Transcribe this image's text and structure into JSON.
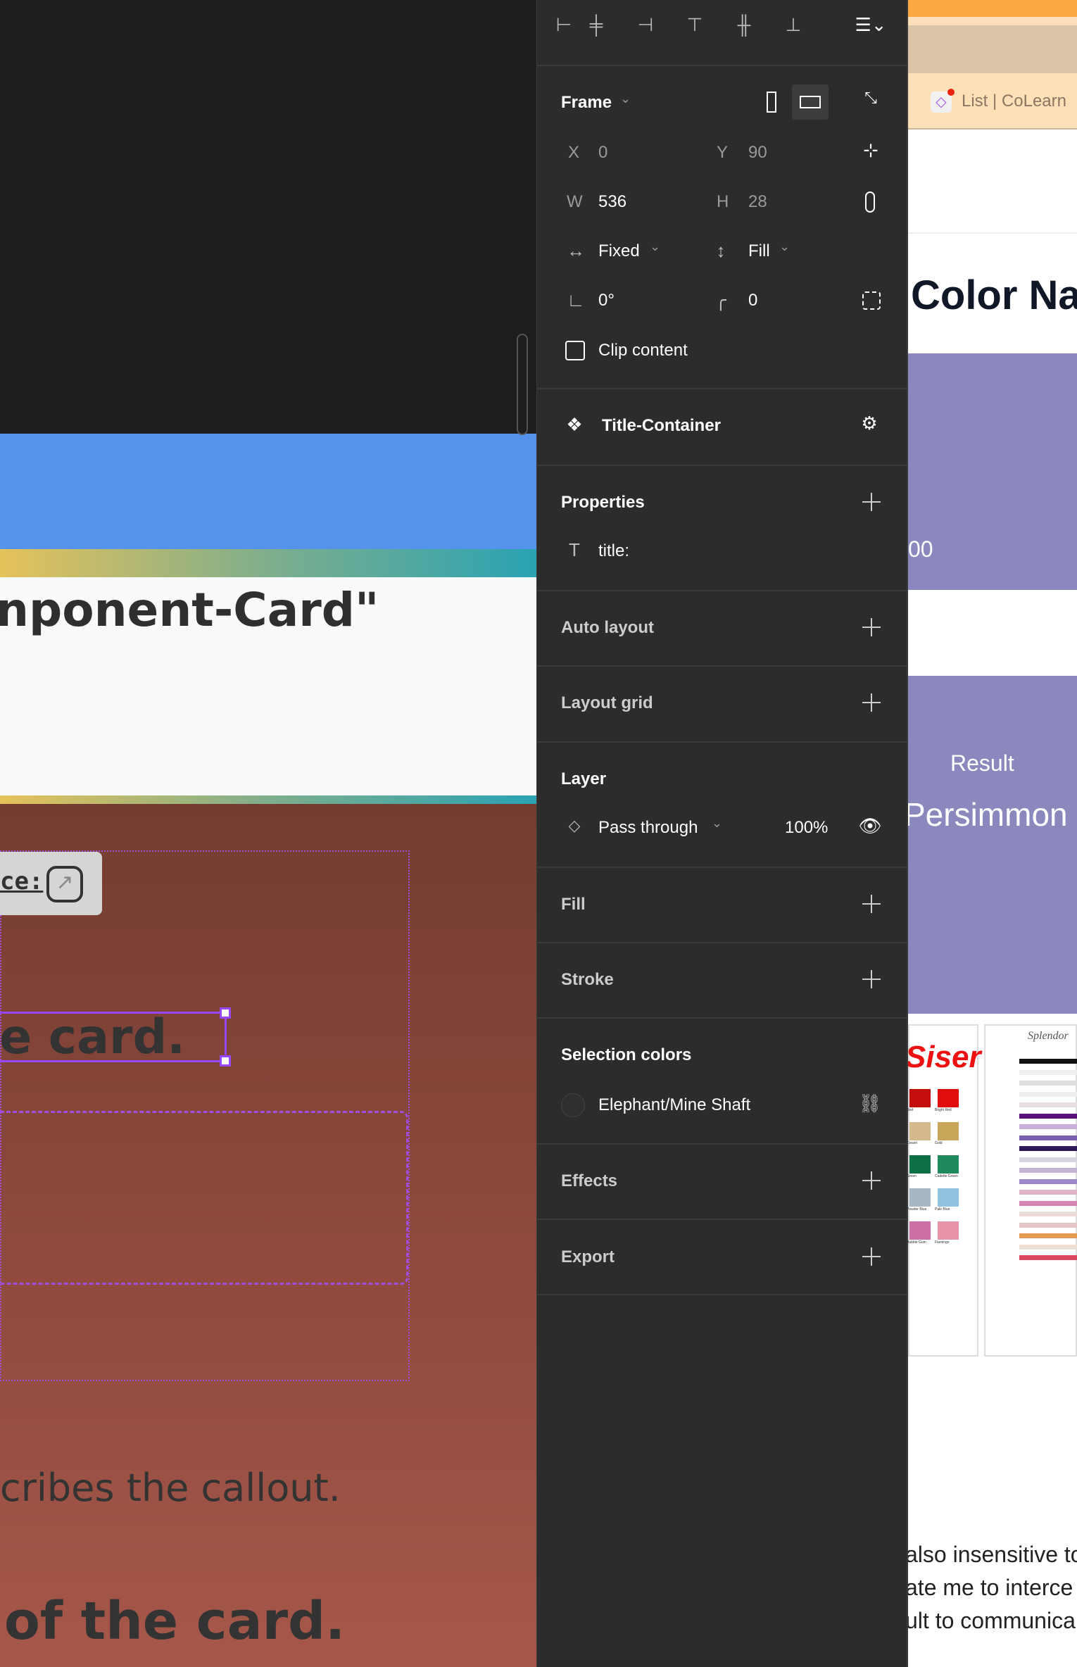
{
  "canvas": {
    "title_fragment": "nponent-Card\"",
    "link_label_fragment": "ce:",
    "selected_text_fragment": "e card.",
    "description_fragment": "cribes the callout.",
    "footer_fragment": "of the card.",
    "colors": {
      "blue": "#5592ea",
      "brown_top": "#743c31",
      "brown_bottom": "#a65749",
      "selection": "#9747ff"
    }
  },
  "panel": {
    "toolbar": {
      "icons": [
        "align-left-icon",
        "align-center-h-icon",
        "align-right-icon",
        "align-top-icon",
        "align-middle-v-icon",
        "align-bottom-icon",
        "distribute-icon"
      ]
    },
    "frame": {
      "label": "Frame",
      "x_label": "X",
      "x": "0",
      "y_label": "Y",
      "y": "90",
      "w_label": "W",
      "w": "536",
      "h_label": "H",
      "h": "28",
      "h_sizing": "Fixed",
      "v_sizing": "Fill",
      "rotation": "0°",
      "radius": "0",
      "clip_label": "Clip content",
      "clip_checked": false
    },
    "component": {
      "label": "Title-Container"
    },
    "properties": {
      "label": "Properties",
      "items": [
        {
          "label": "title:"
        }
      ]
    },
    "auto_layout": {
      "label": "Auto layout"
    },
    "layout_grid": {
      "label": "Layout grid"
    },
    "layer": {
      "label": "Layer",
      "blend": "Pass through",
      "opacity": "100%"
    },
    "fill": {
      "label": "Fill"
    },
    "stroke": {
      "label": "Stroke"
    },
    "selection_colors": {
      "label": "Selection colors",
      "items": [
        {
          "name": "Elephant/Mine Shaft",
          "color": "#2f2f2f"
        }
      ]
    },
    "effects": {
      "label": "Effects"
    },
    "export": {
      "label": "Export"
    }
  },
  "web": {
    "tab_title": "List | CoLearn",
    "heading_fragment": "Color Na",
    "value_fragment": "00",
    "result_label": "Result",
    "result_value": "Persimmon",
    "result_bg": "#8a88bd",
    "text_lines": [
      "also insensitive to",
      "ate me to interce",
      "ult to communica"
    ],
    "siser_logo": "Siser",
    "siser_swatches": [
      {
        "name": "Red",
        "color": "#c40d0d"
      },
      {
        "name": "Bright Red",
        "color": "#e00d0d"
      },
      {
        "name": "Cream",
        "color": "#d4b98c"
      },
      {
        "name": "Gold",
        "color": "#c9a75a"
      },
      {
        "name": "Green",
        "color": "#0e6e46"
      },
      {
        "name": "Cadette Green",
        "color": "#1e8a5e"
      },
      {
        "name": "Powder Blue",
        "color": "#a7b7c4"
      },
      {
        "name": "Pale Blue",
        "color": "#93c1e0"
      },
      {
        "name": "Bubble Gum",
        "color": "#cc6fa6"
      },
      {
        "name": "Flamingo",
        "color": "#e993a8"
      }
    ],
    "splendor_logo": "Splendor"
  }
}
